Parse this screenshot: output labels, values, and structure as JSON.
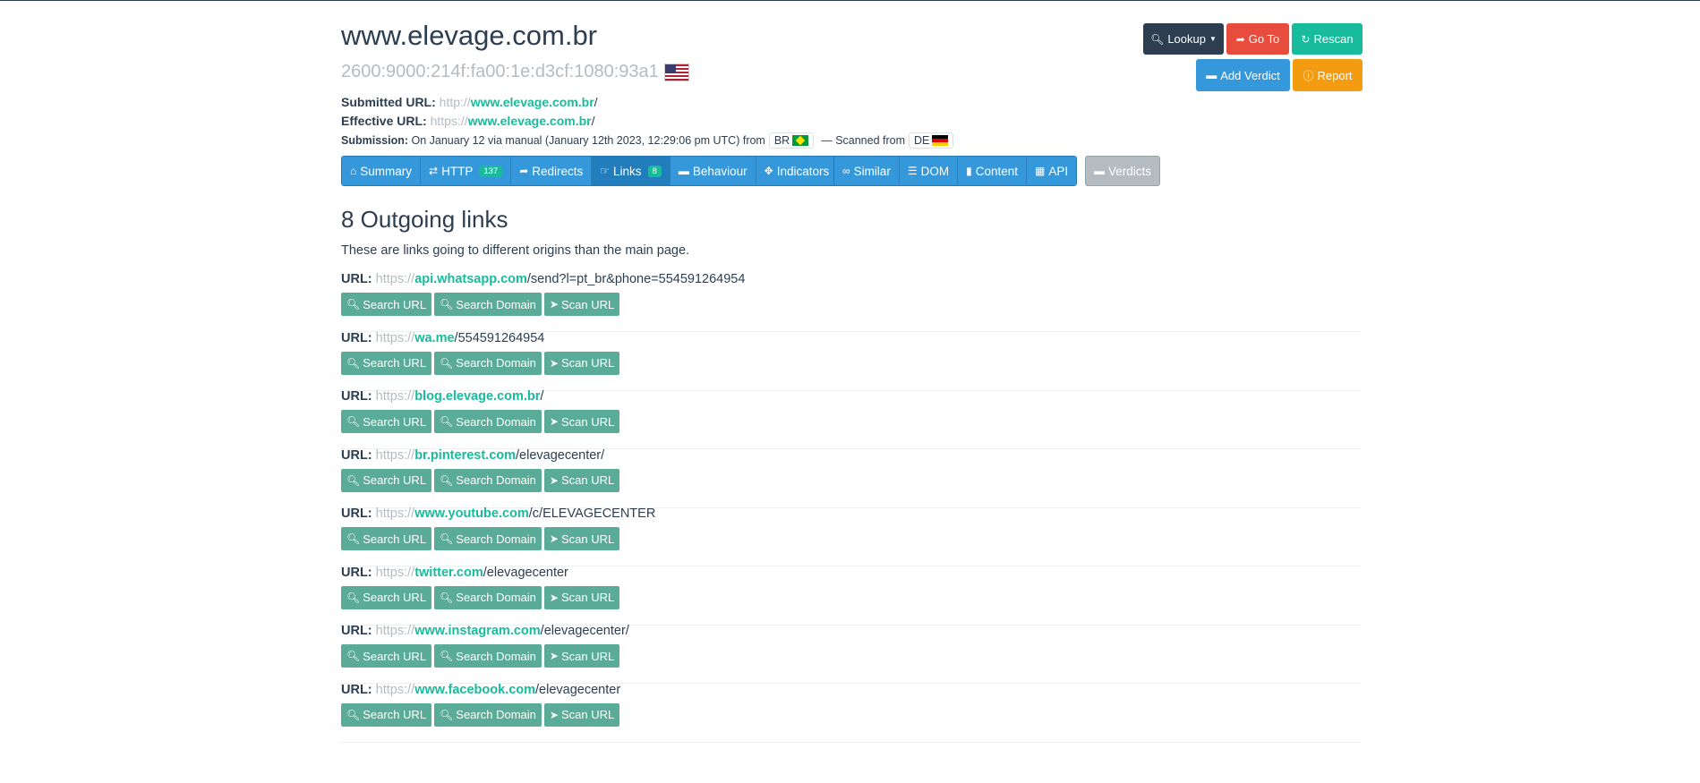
{
  "header": {
    "domain": "www.elevage.com.br",
    "ip": "2600:9000:214f:fa00:1e:d3cf:1080:93a1",
    "submitted_label": "Submitted URL:",
    "submitted_scheme": "http://",
    "submitted_host": "www.elevage.com.br",
    "submitted_path": "/",
    "effective_label": "Effective URL:",
    "effective_scheme": "https://",
    "effective_host": "www.elevage.com.br",
    "effective_path": "/",
    "submission_label": "Submission:",
    "submission_text": "On January 12 via manual (January 12th 2023, 12:29:06 pm UTC) from",
    "submission_country": "BR",
    "scanned_text": "— Scanned from",
    "scanned_country": "DE"
  },
  "actions": {
    "lookup": "Lookup",
    "goto": "Go To",
    "rescan": "Rescan",
    "add_verdict": "Add Verdict",
    "report": "Report"
  },
  "tabs": [
    {
      "label": "Summary",
      "badge": ""
    },
    {
      "label": "HTTP",
      "badge": "137"
    },
    {
      "label": "Redirects",
      "badge": ""
    },
    {
      "label": "Links",
      "badge": "8"
    },
    {
      "label": "Behaviour",
      "badge": ""
    },
    {
      "label": "Indicators",
      "badge": ""
    },
    {
      "label": "Similar",
      "badge": ""
    },
    {
      "label": "DOM",
      "badge": ""
    },
    {
      "label": "Content",
      "badge": ""
    },
    {
      "label": "API",
      "badge": ""
    },
    {
      "label": "Verdicts",
      "badge": ""
    }
  ],
  "section": {
    "title": "8 Outgoing links",
    "description": "These are links going to different origins than the main page."
  },
  "link_labels": {
    "url": "URL:",
    "search_url": "Search URL",
    "search_domain": "Search Domain",
    "scan_url": "Scan URL"
  },
  "links": [
    {
      "scheme": "https://",
      "host": "api.whatsapp.com",
      "path": "/send?l=pt_br&phone=554591264954"
    },
    {
      "scheme": "https://",
      "host": "wa.me",
      "path": "/554591264954"
    },
    {
      "scheme": "https://",
      "host": "blog.elevage.com.br",
      "path": "/"
    },
    {
      "scheme": "https://",
      "host": "br.pinterest.com",
      "path": "/elevagecenter/"
    },
    {
      "scheme": "https://",
      "host": "www.youtube.com",
      "path": "/c/ELEVAGECENTER"
    },
    {
      "scheme": "https://",
      "host": "twitter.com",
      "path": "/elevagecenter"
    },
    {
      "scheme": "https://",
      "host": "www.instagram.com",
      "path": "/elevagecenter/"
    },
    {
      "scheme": "https://",
      "host": "www.facebook.com",
      "path": "/elevagecenter"
    }
  ],
  "colors": {
    "primary": "#2c3e50",
    "success": "#18bc9c",
    "info": "#3498db",
    "danger": "#e74c3c",
    "warning": "#f39c12",
    "muted": "#b4bcc2"
  }
}
